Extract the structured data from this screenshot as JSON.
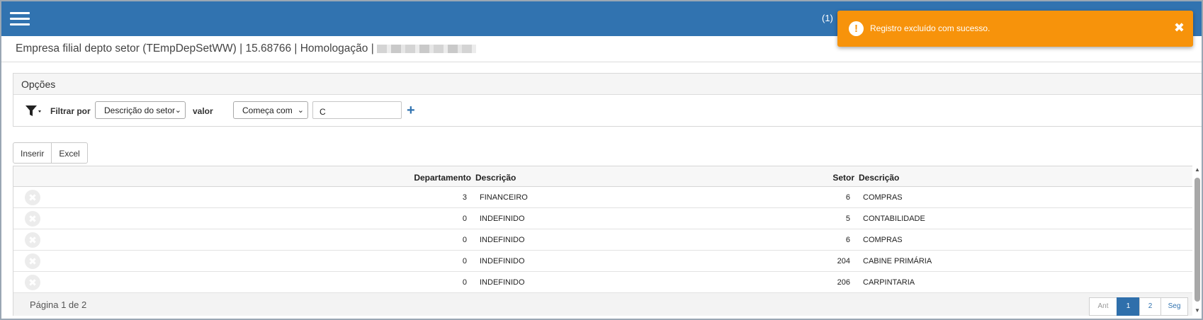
{
  "topbar": {
    "menu_icon": "hamburger-menu-icon",
    "notification_count": "(1)",
    "color": "#3173b0"
  },
  "toast": {
    "icon": "exclamation-circle-icon",
    "icon_symbol": "!",
    "message": "Registro excluído com sucesso.",
    "close_symbol": "✖",
    "color": "#f7930b"
  },
  "header": {
    "title": "Empresa filial depto setor (TEmpDepSetWW) | 15.68766 | Homologação |"
  },
  "options": {
    "title": "Opções",
    "filter_icon": "funnel-dropdown-icon",
    "filter_by_label": "Filtrar por",
    "field_select": "Descrição do setor",
    "value_label": "valor",
    "operator_select": "Começa com",
    "value_input": "C",
    "add_symbol": "+"
  },
  "toolbar": {
    "insert_label": "Inserir",
    "excel_label": "Excel"
  },
  "grid": {
    "headers": {
      "department": "Departamento",
      "department_description": "Descrição",
      "sector": "Setor",
      "sector_description": "Descrição"
    },
    "delete_symbol": "✖",
    "rows": [
      {
        "department": "3",
        "department_description": "FINANCEIRO",
        "sector": "6",
        "sector_description": "COMPRAS"
      },
      {
        "department": "0",
        "department_description": "INDEFINIDO",
        "sector": "5",
        "sector_description": "CONTABILIDADE"
      },
      {
        "department": "0",
        "department_description": "INDEFINIDO",
        "sector": "6",
        "sector_description": "COMPRAS"
      },
      {
        "department": "0",
        "department_description": "INDEFINIDO",
        "sector": "204",
        "sector_description": "CABINE PRIMÁRIA"
      },
      {
        "department": "0",
        "department_description": "INDEFINIDO",
        "sector": "206",
        "sector_description": "CARPINTARIA"
      }
    ]
  },
  "pagination": {
    "info": "Página 1 de 2",
    "prev_label": "Ant",
    "pages": [
      "1",
      "2"
    ],
    "current_page": "1",
    "next_label": "Seg"
  }
}
